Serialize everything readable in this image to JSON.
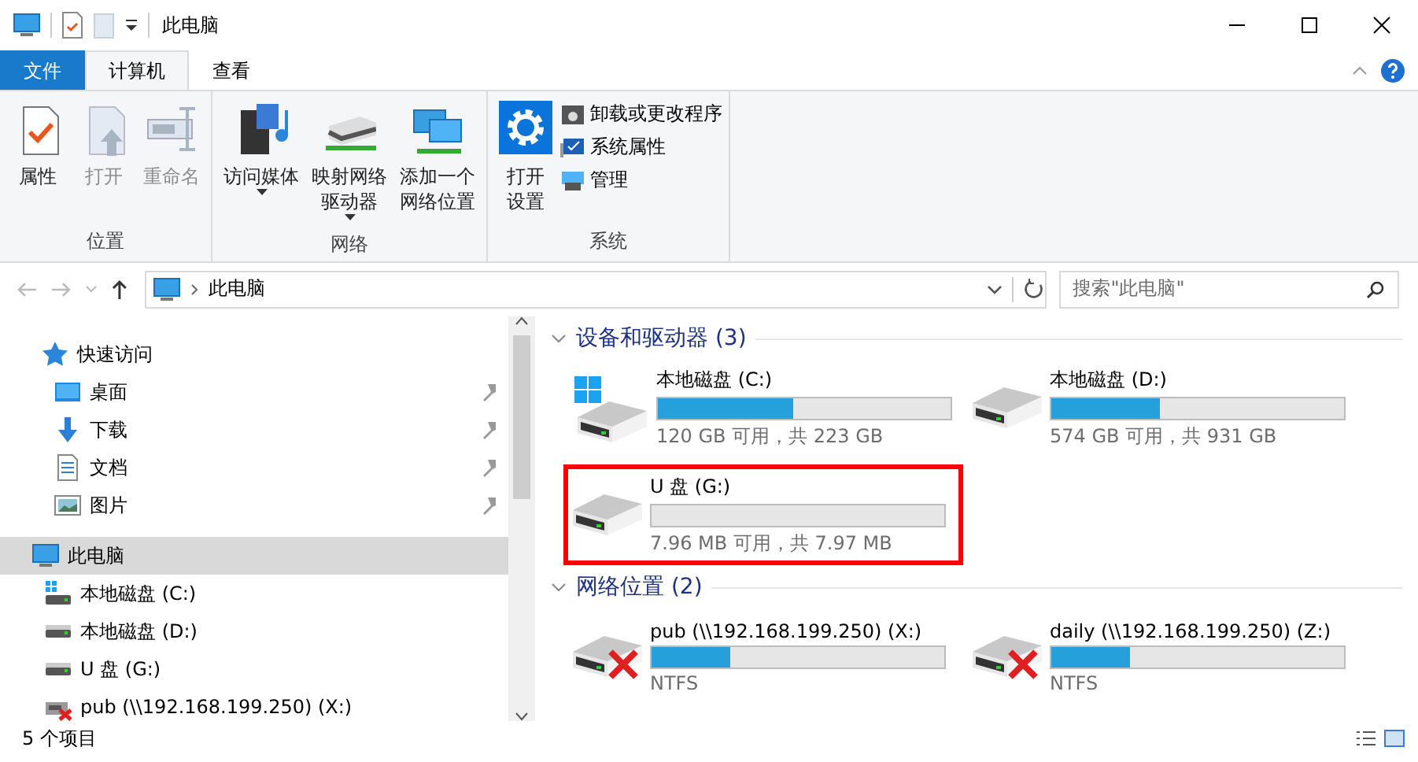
{
  "window": {
    "title": "此电脑"
  },
  "tabs": [
    {
      "label": "文件",
      "kind": "file",
      "selected": false
    },
    {
      "label": "计算机",
      "kind": "tab",
      "selected": true
    },
    {
      "label": "查看",
      "kind": "tab",
      "selected": false
    }
  ],
  "ribbon": {
    "groups": [
      {
        "label": "位置",
        "buttons": [
          {
            "lines": [
              "属性"
            ],
            "kind": "properties",
            "disabled": false
          },
          {
            "lines": [
              "打开"
            ],
            "kind": "open",
            "disabled": true
          },
          {
            "lines": [
              "重命名"
            ],
            "kind": "rename",
            "disabled": true
          }
        ]
      },
      {
        "label": "网络",
        "buttons": [
          {
            "lines": [
              "访问媒体"
            ],
            "kind": "media",
            "disabled": false,
            "dropdown": true
          },
          {
            "lines": [
              "映射网络",
              "驱动器"
            ],
            "kind": "map-drive",
            "disabled": false,
            "dropdown": true
          },
          {
            "lines": [
              "添加一个",
              "网络位置"
            ],
            "kind": "add-location",
            "disabled": false
          }
        ]
      },
      {
        "label": "系统",
        "buttons": [
          {
            "lines": [
              "打开",
              "设置"
            ],
            "kind": "settings",
            "disabled": false
          }
        ],
        "small_buttons": [
          {
            "label": "卸载或更改程序",
            "kind": "uninstall"
          },
          {
            "label": "系统属性",
            "kind": "system-properties"
          },
          {
            "label": "管理",
            "kind": "manage"
          }
        ]
      }
    ]
  },
  "address_bar": {
    "path": "此电脑",
    "search_placeholder": "搜索\"此电脑\""
  },
  "sidebar": {
    "items": [
      {
        "label": "快速访问",
        "kind": "quick-access",
        "selected": false,
        "children": [
          {
            "label": "桌面",
            "kind": "desktop",
            "selected": false,
            "pinned": true
          },
          {
            "label": "下载",
            "kind": "downloads",
            "selected": false,
            "pinned": true
          },
          {
            "label": "文档",
            "kind": "documents",
            "selected": false,
            "pinned": true
          },
          {
            "label": "图片",
            "kind": "pictures",
            "selected": false,
            "pinned": true
          }
        ]
      },
      {
        "label": "此电脑",
        "kind": "computer",
        "selected": true,
        "children": [
          {
            "label": "本地磁盘 (C:)",
            "kind": "system-drive",
            "selected": false,
            "pinned": false
          },
          {
            "label": "本地磁盘 (D:)",
            "kind": "drive",
            "selected": false,
            "pinned": false
          },
          {
            "label": "U 盘 (G:)",
            "kind": "drive",
            "selected": false,
            "pinned": false
          },
          {
            "label": "pub (\\\\192.168.199.250) (X:)",
            "kind": "network-drive",
            "selected": false,
            "pinned": false
          }
        ]
      }
    ]
  },
  "sections": [
    {
      "title": "设备和驱动器 (3)",
      "expanded": true,
      "items": [
        {
          "name": "本地磁盘 (C:)",
          "kind": "system-drive",
          "level": 0.46,
          "detail": "120 GB 可用，共 223 GB"
        },
        {
          "name": "本地磁盘 (D:)",
          "kind": "drive",
          "level": 0.37,
          "detail": "574 GB 可用，共 931 GB"
        },
        {
          "name": "U 盘 (G:)",
          "kind": "drive",
          "detail": "7.96 MB 可用，共 7.97 MB",
          "highlighted": true
        }
      ]
    },
    {
      "title": "网络位置 (2)",
      "expanded": true,
      "items": [
        {
          "name": "pub (\\\\192.168.199.250) (X:)",
          "kind": "network-drive",
          "level": 0.27,
          "detail": "NTFS"
        },
        {
          "name": "daily (\\\\192.168.199.250) (Z:)",
          "kind": "network-drive",
          "level": 0.27,
          "detail": "NTFS"
        }
      ]
    }
  ],
  "status_bar": {
    "count": "5 个项目"
  }
}
